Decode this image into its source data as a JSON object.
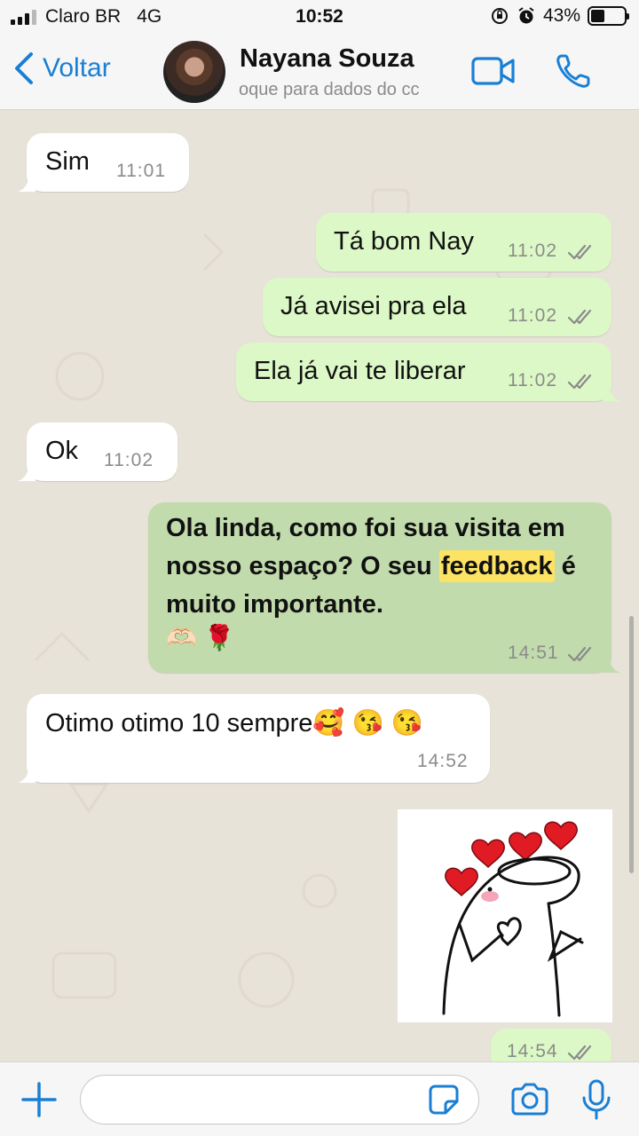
{
  "status_bar": {
    "carrier": "Claro BR",
    "network": "4G",
    "time": "10:52",
    "battery": "43%",
    "battery_level": 0.43
  },
  "header": {
    "back_label": "Voltar",
    "contact_name": "Nayana Souza",
    "contact_subtitle": "oque para dados do cc"
  },
  "messages": [
    {
      "dir": "in",
      "text": "Sim",
      "time": "11:01"
    },
    {
      "dir": "out",
      "text": "Tá bom Nay",
      "time": "11:02",
      "status": "read"
    },
    {
      "dir": "out",
      "text": "Já avisei pra ela",
      "time": "11:02",
      "status": "read"
    },
    {
      "dir": "out",
      "text": "Ela já vai te liberar",
      "time": "11:02",
      "status": "read"
    },
    {
      "dir": "in",
      "text": "Ok",
      "time": "11:02"
    },
    {
      "dir": "out",
      "text_before": "Ola linda, como foi sua visita em nosso espaço? O seu ",
      "highlight": "feedback",
      "text_after": " é muito importante.",
      "emoji": "🫶🏻 🌹",
      "time": "14:51",
      "status": "read"
    },
    {
      "dir": "in",
      "text": "Otimo otimo 10 sempre🥰 😘 😘",
      "time": "14:52"
    },
    {
      "dir": "out",
      "type": "sticker",
      "sticker": "flork-hearts-sticker",
      "time": "14:54",
      "status": "read"
    }
  ],
  "input": {
    "placeholder": ""
  },
  "colors": {
    "accent": "#1a7fd4",
    "incoming": "#ffffff",
    "outgoing": "#dcf8c6",
    "highlight": "#fde364",
    "chat_bg": "#e8e3d9"
  },
  "icons": [
    "back-chevron-icon",
    "video-call-icon",
    "phone-icon",
    "plus-icon",
    "sticker-icon",
    "camera-icon",
    "microphone-icon",
    "read-ticks-icon"
  ]
}
